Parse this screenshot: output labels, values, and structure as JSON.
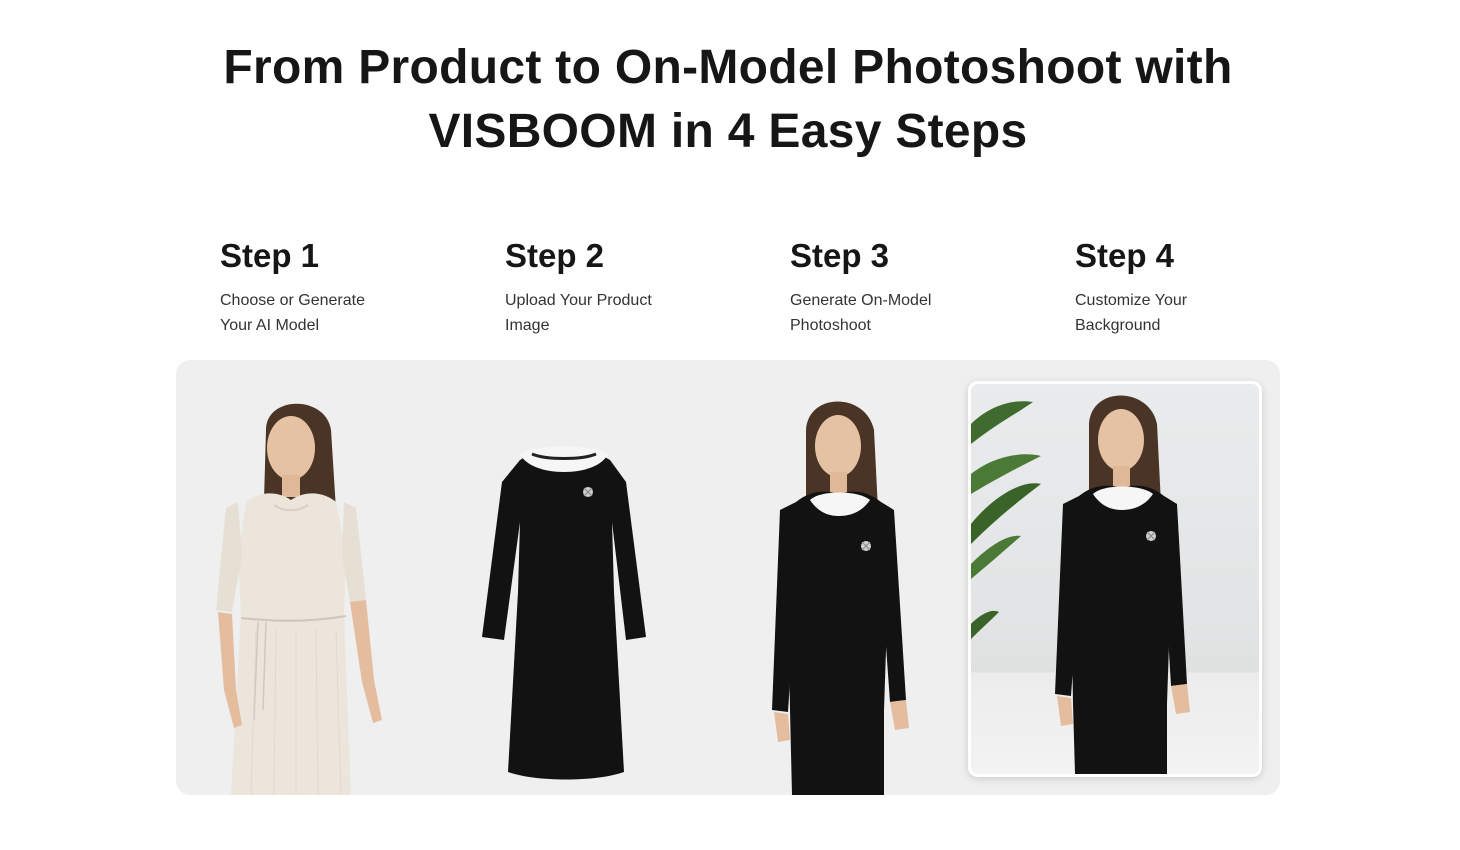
{
  "header": {
    "title_line1": "From Product to On-Model Photoshoot with",
    "title_line2": "VISBOOM in 4 Easy Steps"
  },
  "steps": [
    {
      "title": "Step 1",
      "desc_line1": "Choose or Generate",
      "desc_line2": "Your AI Model"
    },
    {
      "title": "Step 2",
      "desc_line1": "Upload Your Product",
      "desc_line2": "Image"
    },
    {
      "title": "Step 3",
      "desc_line1": "Generate On-Model",
      "desc_line2": "Photoshoot"
    },
    {
      "title": "Step 4",
      "desc_line1": "Customize Your",
      "desc_line2": "Background"
    }
  ],
  "colors": {
    "panel_bg": "#efefef",
    "text": "#161616",
    "dress_black": "#121212",
    "dress_cream": "#ebe5dc"
  },
  "images": [
    {
      "icon": "model-in-cream-dress-image"
    },
    {
      "icon": "black-dress-product-image"
    },
    {
      "icon": "model-in-black-dress-image"
    },
    {
      "icon": "model-with-plant-background-image"
    }
  ]
}
